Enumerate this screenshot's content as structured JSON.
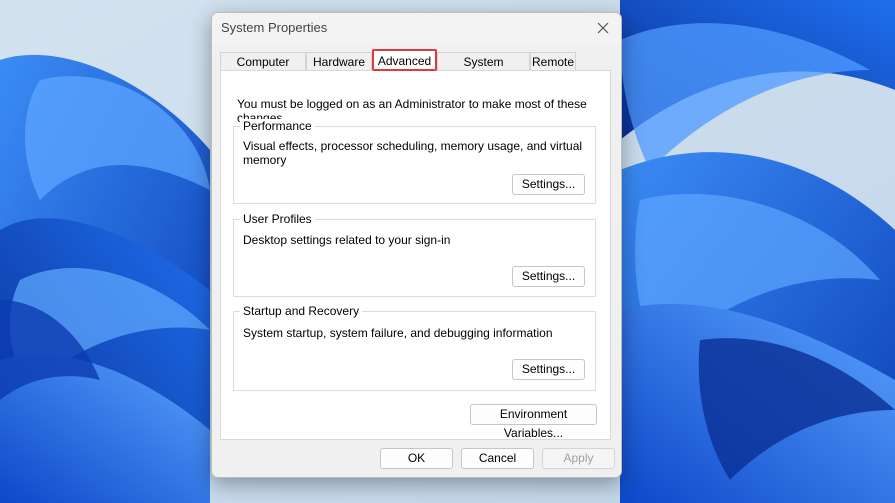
{
  "dialog": {
    "title": "System Properties",
    "close_icon": "close-icon"
  },
  "tabs": [
    {
      "label": "Computer Name",
      "active": false
    },
    {
      "label": "Hardware",
      "active": false
    },
    {
      "label": "Advanced",
      "active": true
    },
    {
      "label": "System Protection",
      "active": false
    },
    {
      "label": "Remote",
      "active": false
    }
  ],
  "advanced": {
    "admin_note": "You must be logged on as an Administrator to make most of these changes.",
    "performance": {
      "title": "Performance",
      "description": "Visual effects, processor scheduling, memory usage, and virtual memory",
      "button": "Settings..."
    },
    "user_profiles": {
      "title": "User Profiles",
      "description": "Desktop settings related to your sign-in",
      "button": "Settings..."
    },
    "startup_recovery": {
      "title": "Startup and Recovery",
      "description": "System startup, system failure, and debugging information",
      "button": "Settings..."
    },
    "environment_variables": "Environment Variables..."
  },
  "footer": {
    "ok": "OK",
    "cancel": "Cancel",
    "apply": "Apply",
    "apply_disabled": true
  },
  "colors": {
    "highlight": "#e23a3a",
    "arrow": "#e8453c",
    "wallpaper": "#1565e0"
  }
}
